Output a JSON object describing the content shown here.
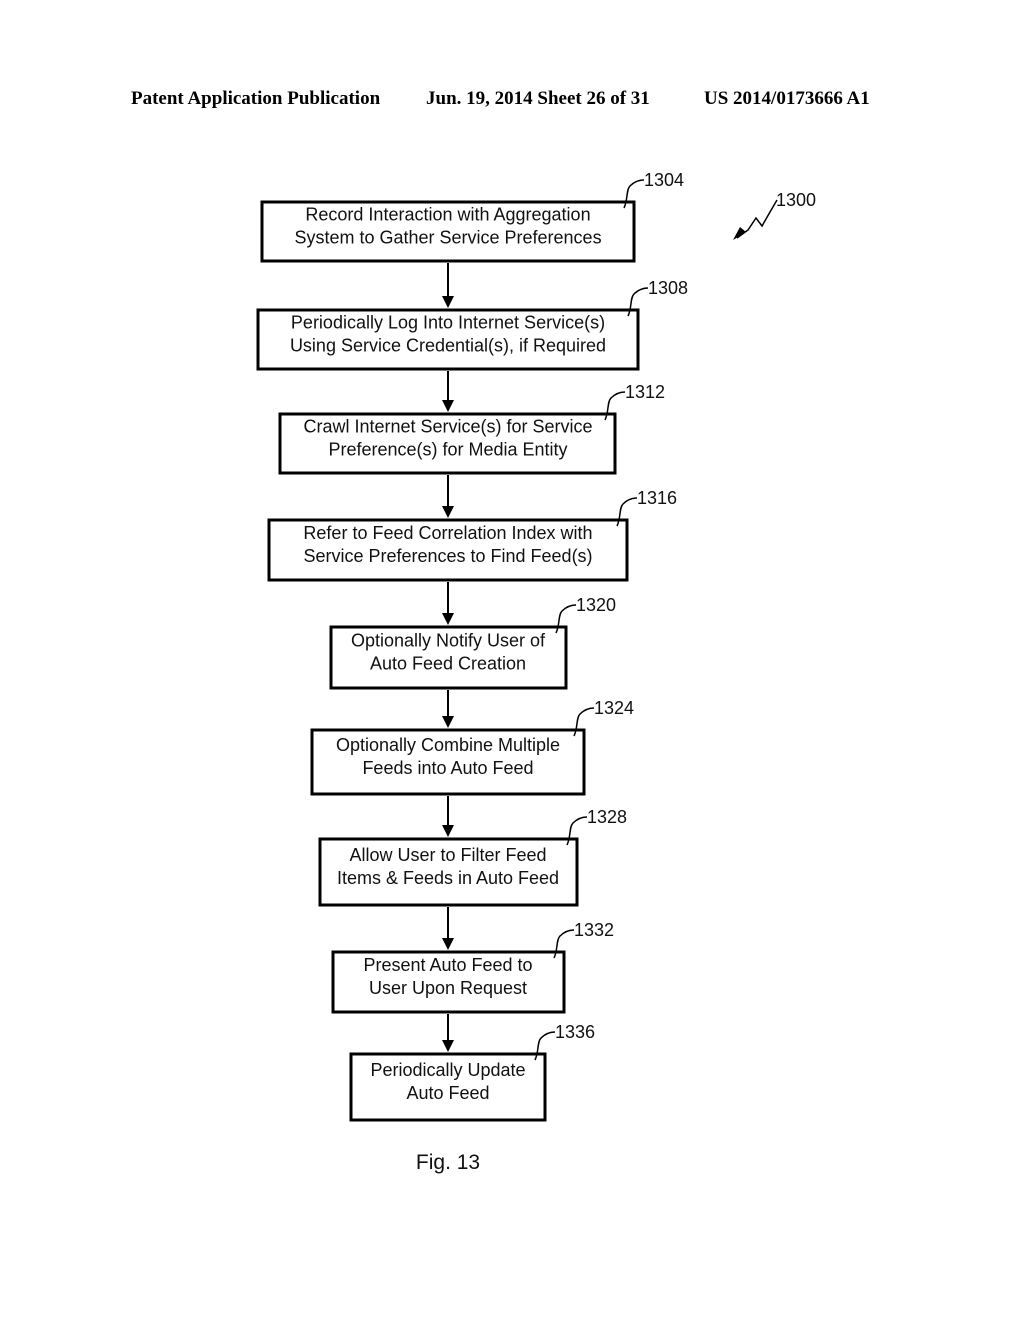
{
  "header": {
    "left": "Patent Application Publication",
    "middle": "Jun. 19, 2014  Sheet 26 of 31",
    "right": "US 2014/0173666 A1"
  },
  "figure": {
    "ref": "1300",
    "caption": "Fig. 13"
  },
  "steps": [
    {
      "ref": "1304",
      "lines": [
        "Record Interaction with Aggregation",
        "System to Gather Service Preferences"
      ]
    },
    {
      "ref": "1308",
      "lines": [
        "Periodically Log Into Internet Service(s)",
        "Using Service Credential(s), if Required"
      ]
    },
    {
      "ref": "1312",
      "lines": [
        "Crawl Internet Service(s) for Service",
        "Preference(s) for Media Entity"
      ]
    },
    {
      "ref": "1316",
      "lines": [
        "Refer to Feed Correlation Index with",
        "Service Preferences to Find Feed(s)"
      ]
    },
    {
      "ref": "1320",
      "lines": [
        "Optionally Notify User of",
        "Auto Feed Creation"
      ]
    },
    {
      "ref": "1324",
      "lines": [
        "Optionally Combine Multiple",
        "Feeds into Auto Feed"
      ]
    },
    {
      "ref": "1328",
      "lines": [
        "Allow User to Filter Feed",
        "Items & Feeds in Auto Feed"
      ]
    },
    {
      "ref": "1332",
      "lines": [
        "Present Auto Feed to",
        "User Upon Request"
      ]
    },
    {
      "ref": "1336",
      "lines": [
        "Periodically Update",
        "Auto Feed"
      ]
    }
  ]
}
